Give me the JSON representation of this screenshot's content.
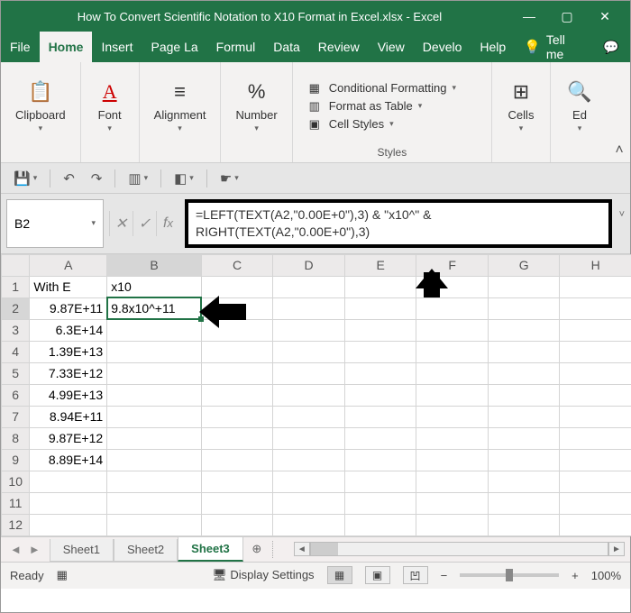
{
  "title": {
    "filename": "How To Convert Scientific Notation to X10 Format in Excel.xlsx",
    "sep": "  -  ",
    "app": "Excel"
  },
  "win": {
    "min": "—",
    "max": "▢",
    "close": "✕"
  },
  "tabs": [
    "File",
    "Home",
    "Insert",
    "Page La",
    "Formul",
    "Data",
    "Review",
    "View",
    "Develo",
    "Help"
  ],
  "active_tab": 1,
  "tellme": "Tell me",
  "ribbon": {
    "clipboard": "Clipboard",
    "font": "Font",
    "alignment": "Alignment",
    "number": "Number",
    "styles_label": "Styles",
    "cond_fmt": "Conditional Formatting",
    "fmt_table": "Format as Table",
    "cell_styles": "Cell Styles",
    "cells": "Cells",
    "editing": "Ed"
  },
  "namebox": "B2",
  "formula": {
    "line1": "=LEFT(TEXT(A2,\"0.00E+0\"),3) & \"x10^\" &",
    "line2": "RIGHT(TEXT(A2,\"0.00E+0\"),3)"
  },
  "columns": [
    "A",
    "B",
    "C",
    "D",
    "E",
    "F",
    "G",
    "H"
  ],
  "headers": {
    "A": "With E",
    "B": "x10"
  },
  "cells": {
    "A2": "9.87E+11",
    "B2": "9.8x10^+11",
    "A3": "6.3E+14",
    "A4": "1.39E+13",
    "A5": "7.33E+12",
    "A6": "4.99E+13",
    "A7": "8.94E+11",
    "A8": "9.87E+12",
    "A9": "8.89E+14"
  },
  "row_count": 12,
  "sheets": [
    "Sheet1",
    "Sheet2",
    "Sheet3"
  ],
  "active_sheet": 2,
  "status": {
    "ready": "Ready",
    "display": "Display Settings",
    "zoom": "100%"
  }
}
